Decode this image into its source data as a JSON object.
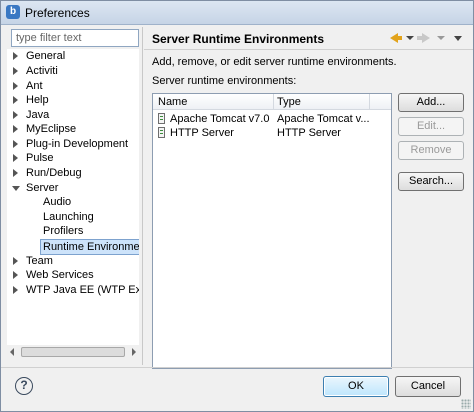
{
  "window": {
    "title": "Preferences"
  },
  "sidebar": {
    "filter_placeholder": "type filter text",
    "items": [
      {
        "label": "General",
        "expanded": false
      },
      {
        "label": "Activiti",
        "expanded": false
      },
      {
        "label": "Ant",
        "expanded": false
      },
      {
        "label": "Help",
        "expanded": false
      },
      {
        "label": "Java",
        "expanded": false
      },
      {
        "label": "MyEclipse",
        "expanded": false
      },
      {
        "label": "Plug-in Development",
        "expanded": false
      },
      {
        "label": "Pulse",
        "expanded": false
      },
      {
        "label": "Run/Debug",
        "expanded": false
      },
      {
        "label": "Server",
        "expanded": true
      },
      {
        "label": "Audio",
        "child": true
      },
      {
        "label": "Launching",
        "child": true
      },
      {
        "label": "Profilers",
        "child": true
      },
      {
        "label": "Runtime Environments",
        "child": true,
        "selected": true
      },
      {
        "label": "Team",
        "expanded": false
      },
      {
        "label": "Web Services",
        "expanded": false
      },
      {
        "label": "WTP Java EE (WTP Extras)",
        "expanded": false
      }
    ]
  },
  "page": {
    "title": "Server Runtime Environments",
    "description": "Add, remove, or edit server runtime environments.",
    "list_label": "Server runtime environments:",
    "table": {
      "columns": [
        "Name",
        "Type"
      ],
      "rows": [
        {
          "name": "Apache Tomcat v7.0",
          "type": "Apache Tomcat v...",
          "icon": "server-icon"
        },
        {
          "name": "HTTP Server",
          "type": "HTTP Server",
          "icon": "server-icon"
        }
      ]
    },
    "buttons": {
      "add": "Add...",
      "edit": "Edit...",
      "remove": "Remove",
      "search": "Search..."
    }
  },
  "footer": {
    "help_icon": "?",
    "ok": "OK",
    "cancel": "Cancel"
  },
  "colors": {
    "selection": "#cde3fa",
    "nav_back": "#e2a31b",
    "ok_button": "#bee6fd"
  }
}
